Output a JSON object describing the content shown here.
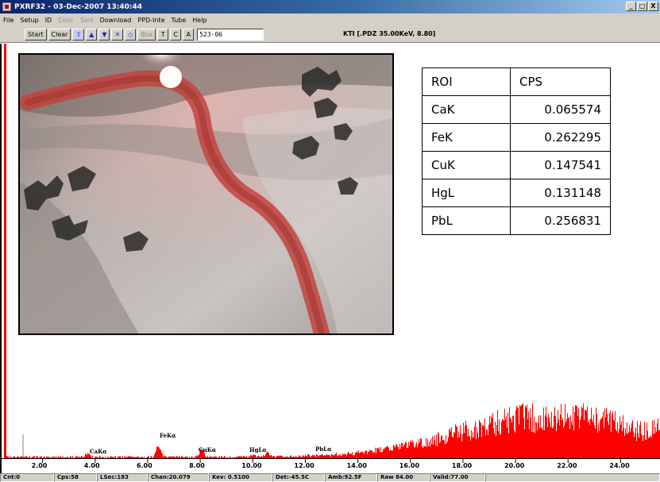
{
  "window": {
    "title": "PXRF32 - 03-Dec-2007 13:40:44",
    "min": "_",
    "max": "□",
    "close": "X"
  },
  "menu": [
    "File",
    "Setup",
    "ID",
    "Conc",
    "Sort",
    "Download",
    "PPD-Inte",
    "Tube",
    "Help"
  ],
  "menu_disabled": [
    false,
    false,
    false,
    true,
    true,
    false,
    false,
    false,
    false
  ],
  "toolbar": {
    "start": "Start",
    "clear": "Clear",
    "up_icon": "⇧",
    "up2_icon": "▲",
    "down_icon": "▼",
    "x_icon": "✕",
    "o_icon": "◇",
    "box": "Box",
    "t": "T",
    "c": "C",
    "a": "A",
    "sample_id": "523-06",
    "status": "KTI  [.PDZ 35.00KeV, 8.80]"
  },
  "roi_table": {
    "headers": [
      "ROI",
      "CPS"
    ],
    "rows": [
      [
        "CaK",
        "0.065574"
      ],
      [
        "FeK",
        "0.262295"
      ],
      [
        "CuK",
        "0.147541"
      ],
      [
        "HgL",
        "0.131148"
      ],
      [
        "PbL",
        "0.256831"
      ]
    ]
  },
  "peak_labels": [
    "CaKα",
    "FeKα",
    "CuKα",
    "HgLα",
    "PbLα"
  ],
  "axis_ticks": [
    "2.00",
    "4.00",
    "6.00",
    "8.00",
    "10.00",
    "12.00",
    "14.00",
    "16.00",
    "18.00",
    "20.00",
    "22.00",
    "24.00"
  ],
  "status": [
    "Cnt:0",
    "Cps:58",
    "LSec:183",
    "Chan:20.079",
    "Kev: 0.5100",
    "Det:-45.5C",
    "Amb:92.5F",
    "Raw 84.00",
    "Valid:77.00"
  ],
  "colors": {
    "spectrum": "#ff0000",
    "titlebar": "#0a246a"
  },
  "chart_data": {
    "type": "bar",
    "xlim": [
      0.5,
      25.5
    ],
    "x_ticks": [
      2,
      4,
      6,
      8,
      10,
      12,
      14,
      16,
      18,
      20,
      22,
      24
    ],
    "peaks": [
      {
        "name": "CaKα",
        "x": 3.69,
        "y": 4
      },
      {
        "name": "FeKα",
        "x": 6.4,
        "y": 14
      },
      {
        "name": "CuKα",
        "x": 8.04,
        "y": 9
      },
      {
        "name": "HgLα",
        "x": 9.99,
        "y": 3
      },
      {
        "name": "PbLα",
        "x": 10.55,
        "y": 5
      }
    ],
    "low_energy_spike": {
      "x": 0.55,
      "y": 560
    },
    "background_hump": {
      "center": 21.5,
      "peak": 55,
      "width": 5
    }
  }
}
